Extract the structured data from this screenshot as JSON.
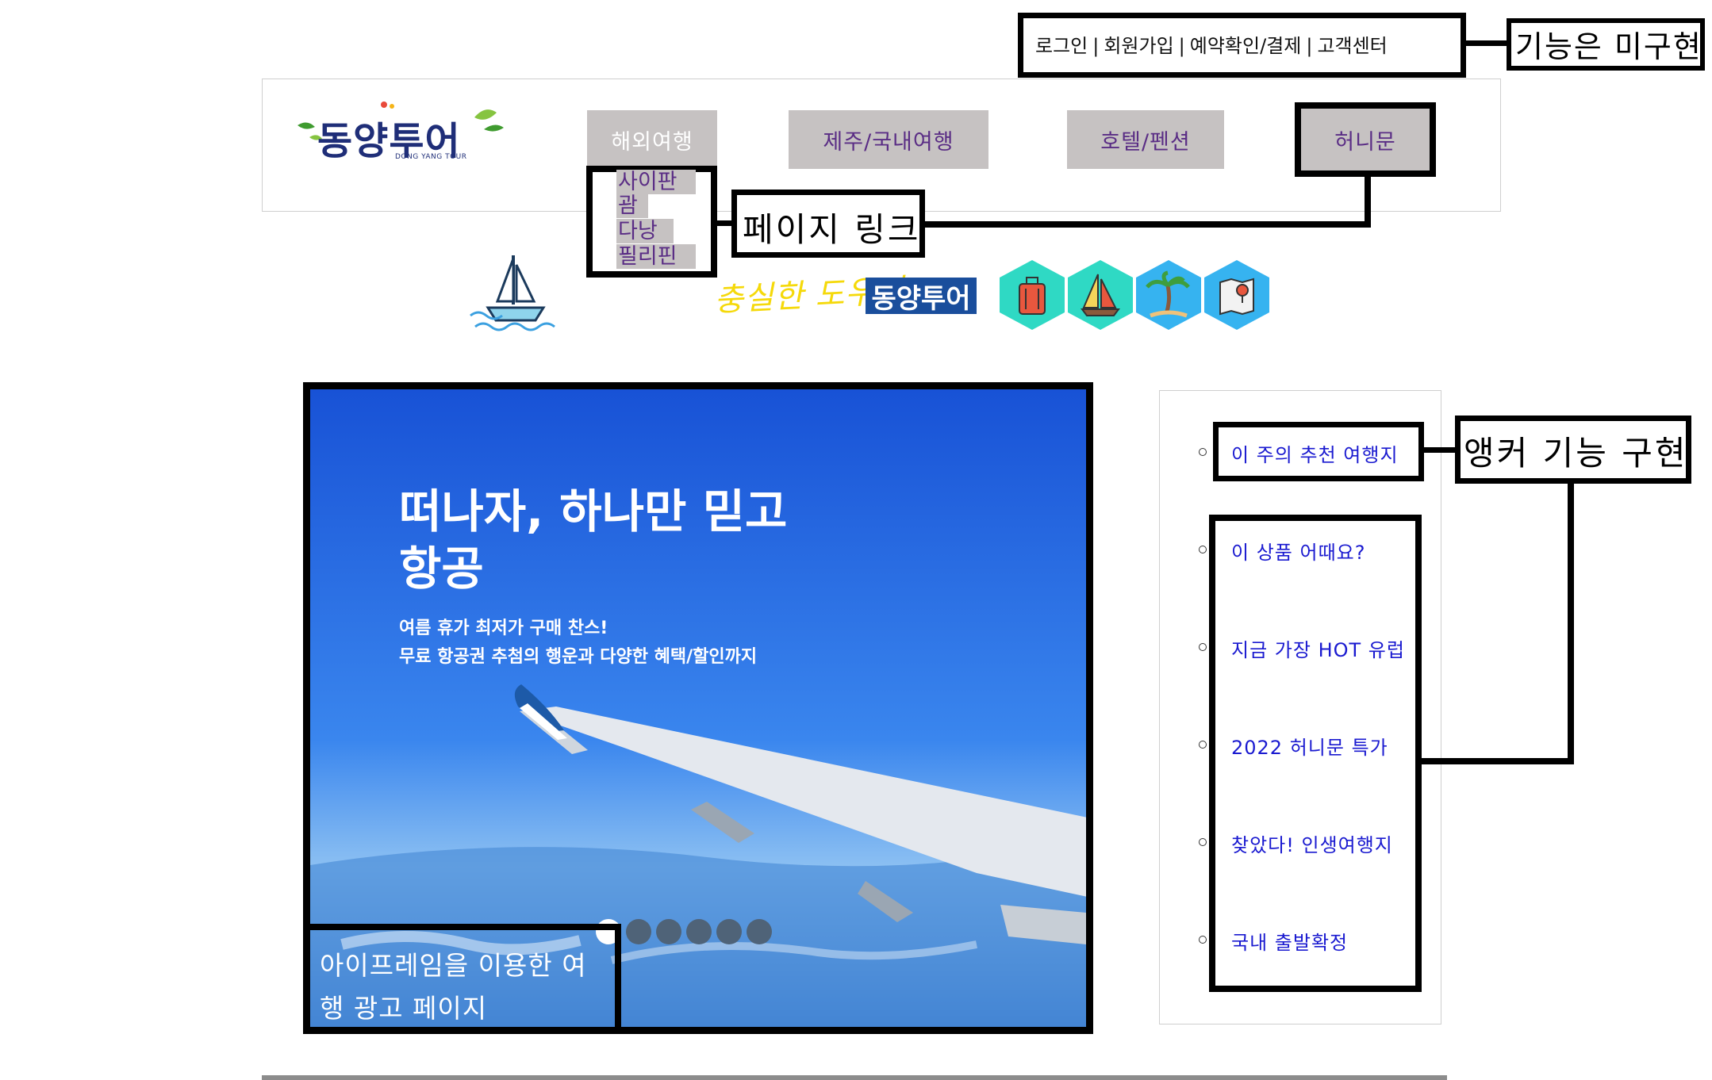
{
  "util": {
    "links": [
      "로그인",
      "회원가입",
      "예약확인/결제",
      "고객센터"
    ],
    "separator": "|"
  },
  "notes": {
    "unimplemented": "기능은 미구현",
    "page_link": "페이지 링크",
    "anchor": "앵커 기능 구현"
  },
  "logo": {
    "name": "동양투어",
    "sub": "DONG YANG TOUR"
  },
  "nav": {
    "overseas": "해외여행",
    "jeju": "제주/국내여행",
    "hotel": "호텔/펜션",
    "honeymoon": "허니문"
  },
  "dropdown": [
    "사이판",
    "괌",
    "다낭",
    "필리핀"
  ],
  "slogan": {
    "script": "충실한 도우미",
    "brand": "동양투어"
  },
  "icons": [
    "suitcase-icon",
    "sailboat-icon",
    "palm-tree-icon",
    "map-icon"
  ],
  "colors": {
    "nav_bg": "#c6c2c2",
    "nav_text": "#5a2d85",
    "anchor_text": "#1a1ad0",
    "ad_blue": "#1e5fe0",
    "hex_teal": "#2fd9c4",
    "hex_blue": "#36b3f0"
  },
  "ad": {
    "title": "떠나자, 하나만 믿고\n항공",
    "desc": "여름 휴가 최저가 구매 찬스!\n무료 항공권 추첨의 행운과 다양한 혜택/할인까지",
    "caption": "아이프레임을 이용한 여행 광고 페이지",
    "slides": 6,
    "active_slide": 1
  },
  "anchors": [
    "이 주의 추천 여행지",
    "이 상품 어때요?",
    "지금 가장 HOT 유럽",
    "2022 허니문 특가",
    "찾았다! 인생여행지",
    "국내 출발확정"
  ]
}
